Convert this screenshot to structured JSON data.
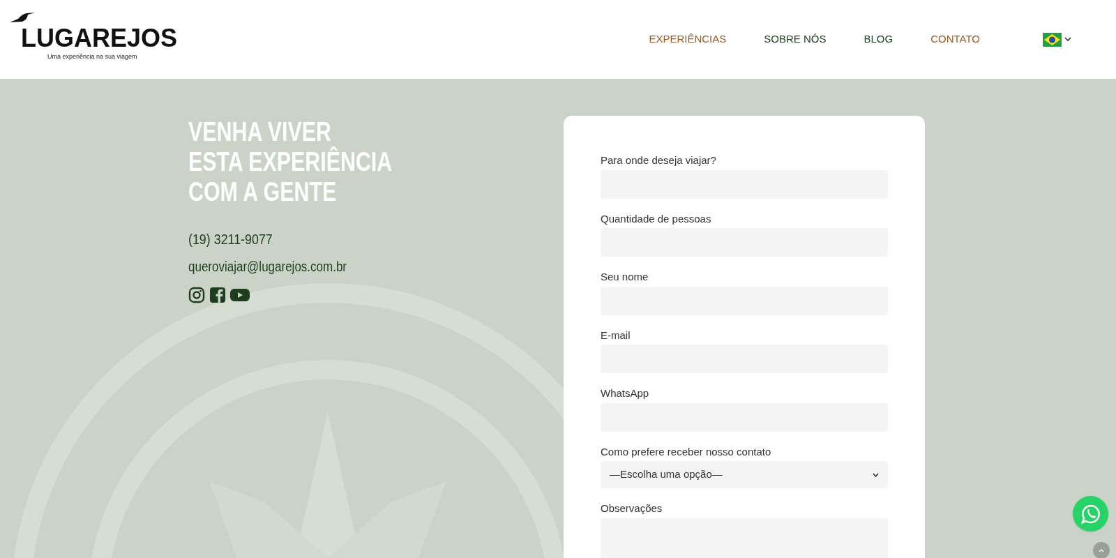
{
  "logo": {
    "wordmark": "LUGAREJOS",
    "tagline": "Uma experiência na sua viagem"
  },
  "nav": [
    {
      "label": "EXPERIÊNCIAS",
      "color": "#9c5a24"
    },
    {
      "label": "SOBRE NÓS",
      "color": "#1f4220"
    },
    {
      "label": "BLOG",
      "color": "#1f4220"
    },
    {
      "label": "CONTATO",
      "color": "#9c5a24"
    }
  ],
  "hero": {
    "heading": [
      "VENHA VIVER",
      "ESTA EXPERIÊNCIA",
      "COM A GENTE"
    ],
    "phone": "(19) 3211-9077",
    "email": "queroviajar@lugarejos.com.br",
    "social": [
      {
        "kind": "instagram"
      },
      {
        "kind": "facebook"
      },
      {
        "kind": "youtube"
      }
    ]
  },
  "form": {
    "fields": [
      {
        "label": "Para onde deseja viajar?",
        "kind": "text"
      },
      {
        "label": "Quantidade de pessoas",
        "kind": "text"
      },
      {
        "label": "Seu nome",
        "kind": "text"
      },
      {
        "label": "E-mail",
        "kind": "text"
      },
      {
        "label": "WhatsApp",
        "kind": "text"
      },
      {
        "label": "Como prefere receber nosso contato",
        "kind": "select",
        "value": "—Escolha uma opção—"
      },
      {
        "label": "Observações",
        "kind": "textarea"
      }
    ]
  }
}
